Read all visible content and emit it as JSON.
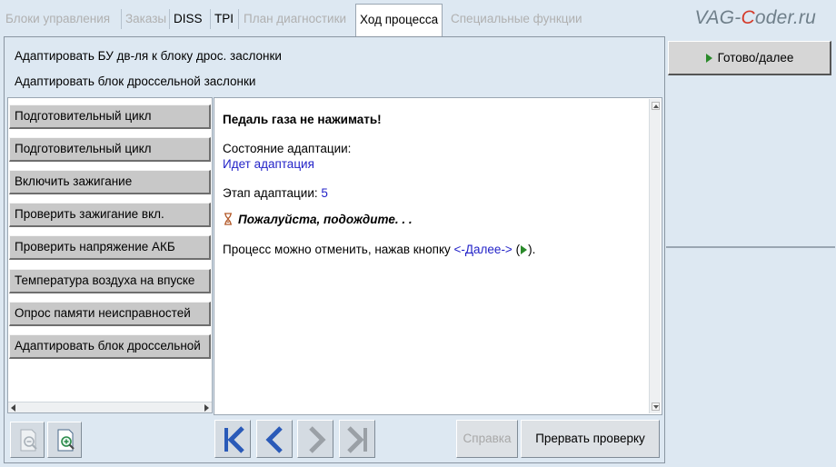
{
  "tabs": [
    {
      "label": "Блоки управления",
      "state": "disabled"
    },
    {
      "label": "Заказы",
      "state": "disabled"
    },
    {
      "label": "DISS",
      "state": "enabled"
    },
    {
      "label": "TPI",
      "state": "enabled"
    },
    {
      "label": "План диагностики",
      "state": "disabled"
    },
    {
      "label": "Ход процесса",
      "state": "active"
    },
    {
      "label": "Специальные функции",
      "state": "disabled"
    }
  ],
  "brand": {
    "prefix": "VAG-",
    "highlight": "C",
    "suffix": "oder.ru"
  },
  "header": {
    "line1": "Адаптировать БУ дв-ля к блоку дрос. заслонки",
    "line2": "Адаптировать блок дроссельной заслонки"
  },
  "steps": [
    "Подготовительный цикл",
    "Подготовительный цикл",
    "Включить зажигание",
    "Проверить зажигание вкл.",
    "Проверить напряжение АКБ",
    "Температура воздуха на впуске",
    "Опрос памяти неисправностей",
    "Адаптировать блок дроссельной"
  ],
  "content": {
    "warning": "Педаль газа не нажимать!",
    "state_label": "Состояние адаптации:",
    "state_value": "Идет адаптация",
    "stage_label": "Этап адаптации:",
    "stage_value": "5",
    "wait_text": "Пожалуйста, подождите. . .",
    "cancel_prefix": "Процесс можно отменить, нажав кнопку ",
    "cancel_link": "<-Далее->",
    "cancel_open": " (",
    "cancel_close": ")."
  },
  "toolbar": {
    "help_label": "Справка",
    "abort_label": "Прервать проверку"
  },
  "right": {
    "next_label": "Готово/далее"
  },
  "colors": {
    "background": "#dde8f2",
    "link_blue": "#2323c8",
    "nav_blue": "#2a5ab8",
    "play_green": "#2a8a2a",
    "brand_red": "#d43b2b"
  }
}
